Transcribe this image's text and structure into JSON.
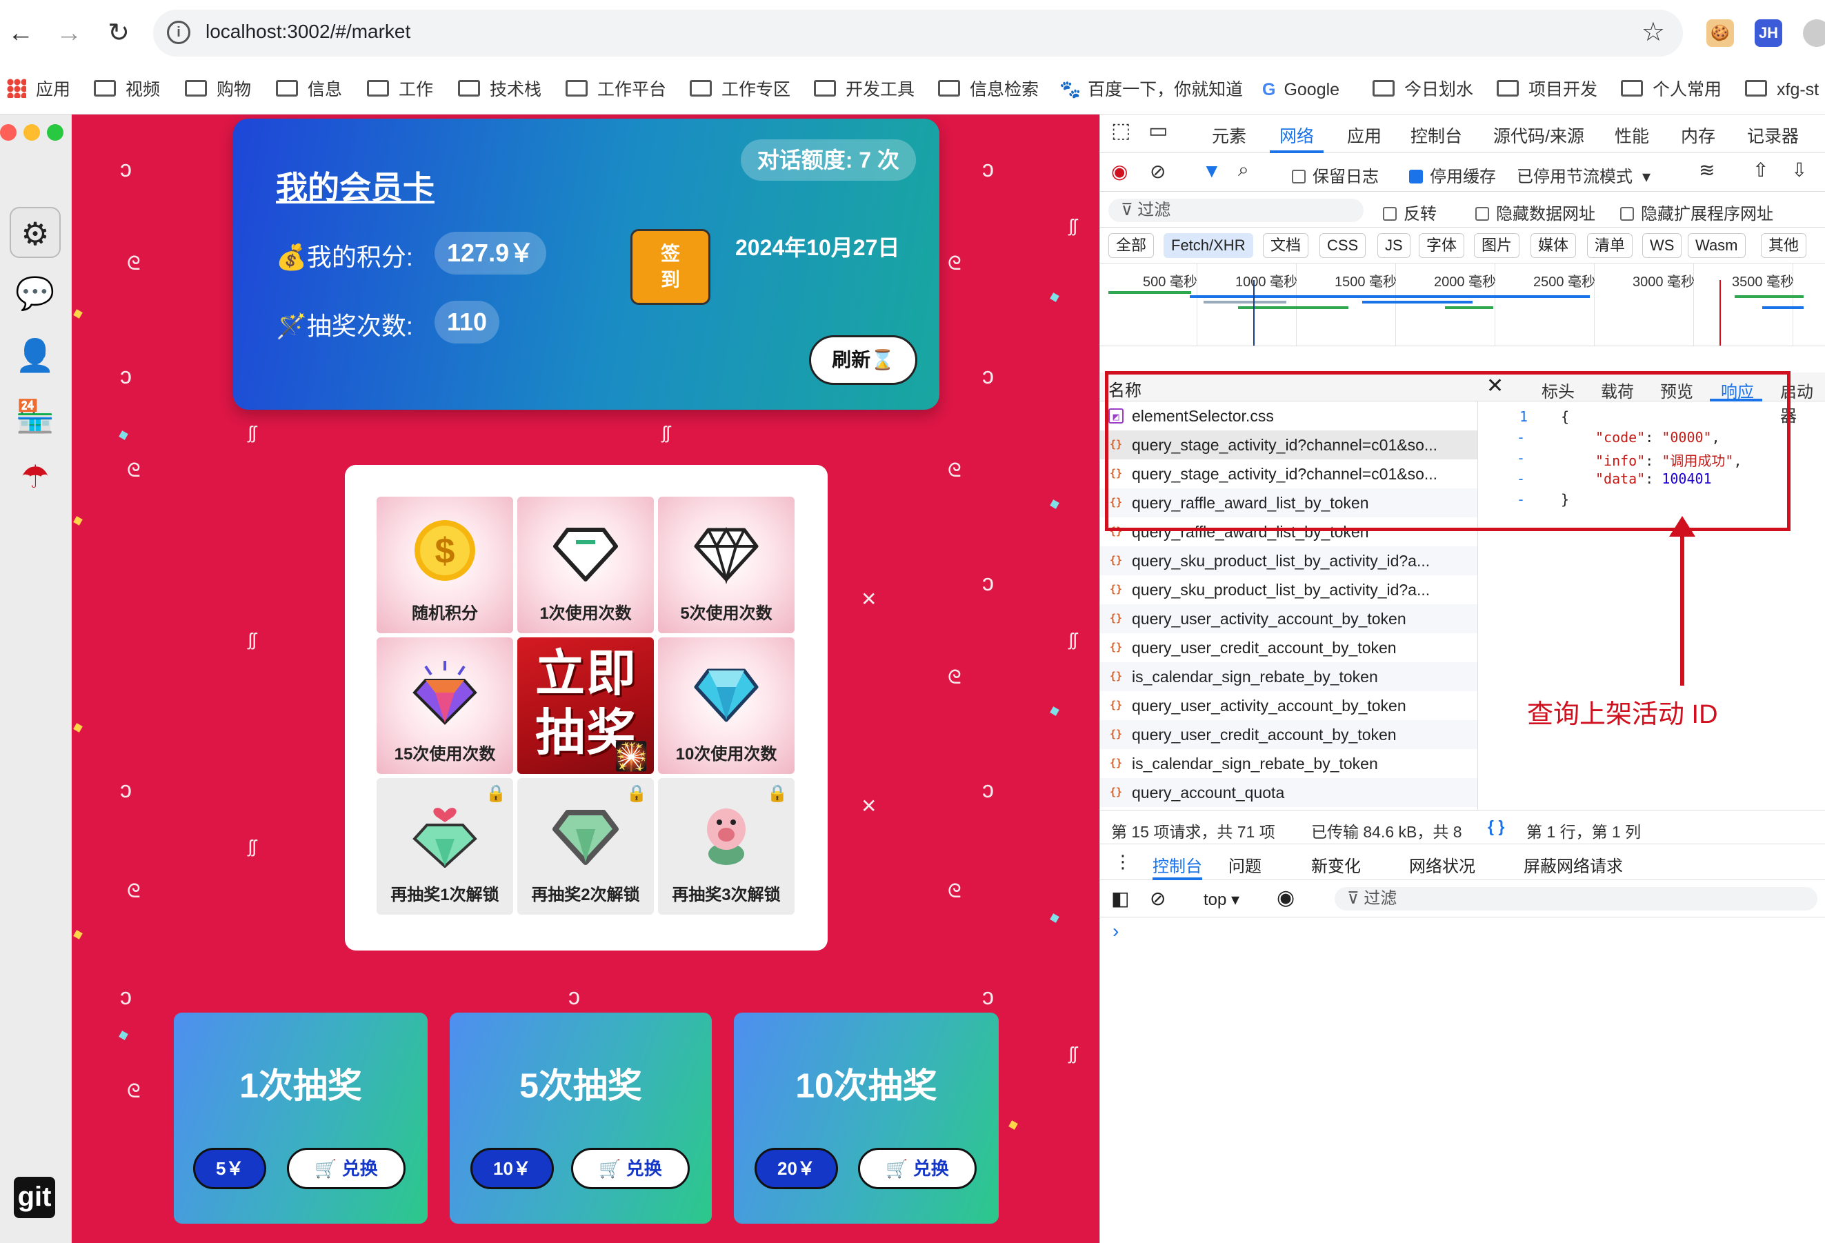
{
  "browser": {
    "url": "localhost:3002/#/market",
    "bookmarks": [
      "应用",
      "视频",
      "购物",
      "信息",
      "工作",
      "技术栈",
      "工作平台",
      "工作专区",
      "开发工具",
      "信息检索",
      "百度一下，你就知道",
      "Google",
      "今日划水",
      "项目开发",
      "个人常用",
      "xfg-st"
    ],
    "ext_badge": "JH"
  },
  "card": {
    "title": "我的会员卡",
    "quota": "对话额度: 7 次",
    "points_label": "💰我的积分:",
    "points_value": "127.9￥",
    "draws_label": "🪄抽奖次数:",
    "draws_value": "110",
    "sign_button": "签到",
    "sign_line1": "签",
    "sign_line2": "到",
    "date": "2024年10月27日",
    "refresh_button": "刷新⌛"
  },
  "lottery": {
    "cells": [
      {
        "label": "随机积分",
        "icon": "coin-icon",
        "locked": false
      },
      {
        "label": "1次使用次数",
        "icon": "diamond-outline-icon",
        "locked": false
      },
      {
        "label": "5次使用次数",
        "icon": "diamond-icon",
        "locked": false
      },
      {
        "label": "15次使用次数",
        "icon": "sparkle-diamond-icon",
        "locked": false
      },
      {
        "label": "10次使用次数",
        "icon": "blue-diamond-icon",
        "locked": false
      },
      {
        "label": "再抽奖1次解锁",
        "icon": "heart-diamond-icon",
        "locked": true
      },
      {
        "label": "再抽奖2次解锁",
        "icon": "grey-diamond-icon",
        "locked": true
      },
      {
        "label": "再抽奖3次解锁",
        "icon": "pig-icon",
        "locked": true
      }
    ],
    "center_text": "立即抽奖",
    "center_line1": "立即",
    "center_line2": "抽奖"
  },
  "draw_options": [
    {
      "title": "1次抽奖",
      "price": "5￥",
      "exchange": "兑换"
    },
    {
      "title": "5次抽奖",
      "price": "10￥",
      "exchange": "兑换"
    },
    {
      "title": "10次抽奖",
      "price": "20￥",
      "exchange": "兑换"
    }
  ],
  "devtools": {
    "tabs": [
      "元素",
      "网络",
      "应用",
      "控制台",
      "源代码/来源",
      "性能",
      "内存",
      "记录器"
    ],
    "active_tab": "网络",
    "toolbar": {
      "preserve_log": "保留日志",
      "disable_cache": "停用缓存",
      "throttle": "已停用节流模式"
    },
    "filter": {
      "placeholder": "过滤",
      "invert": "反转",
      "hide_data_urls": "隐藏数据网址",
      "hide_ext_urls": "隐藏扩展程序网址"
    },
    "types": [
      "全部",
      "Fetch/XHR",
      "文档",
      "CSS",
      "JS",
      "字体",
      "图片",
      "媒体",
      "清单",
      "WS",
      "Wasm",
      "其他"
    ],
    "active_type": "Fetch/XHR",
    "timeline_labels": [
      "500 毫秒",
      "1000 毫秒",
      "1500 毫秒",
      "2000 毫秒",
      "2500 毫秒",
      "3000 毫秒",
      "3500 毫秒"
    ],
    "name_header": "名称",
    "detail_tabs": [
      "标头",
      "载荷",
      "预览",
      "响应",
      "启动器"
    ],
    "active_detail_tab": "响应",
    "requests": [
      "elementSelector.css",
      "query_stage_activity_id?channel=c01&so...",
      "query_stage_activity_id?channel=c01&so...",
      "query_raffle_award_list_by_token",
      "query_raffle_award_list_by_token",
      "query_sku_product_list_by_activity_id?a...",
      "query_sku_product_list_by_activity_id?a...",
      "query_user_activity_account_by_token",
      "query_user_credit_account_by_token",
      "is_calendar_sign_rebate_by_token",
      "query_user_activity_account_by_token",
      "query_user_credit_account_by_token",
      "is_calendar_sign_rebate_by_token",
      "query_account_quota"
    ],
    "response": {
      "line_number": "1",
      "open": "{",
      "code_key": "\"code\"",
      "code_val": "\"0000\"",
      "info_key": "\"info\"",
      "info_val": "\"调用成功\"",
      "data_key": "\"data\"",
      "data_val": "100401",
      "close": "}"
    },
    "status": {
      "count": "第 15 项请求，共 71 项",
      "transferred": "已传输 84.6 kB，共 8",
      "cursor": "第 1 行，第 1 列",
      "format": "{ }"
    },
    "drawer_tabs": [
      "控制台",
      "问题",
      "新变化",
      "网络状况",
      "屏蔽网络请求"
    ],
    "console": {
      "context": "top ▾",
      "filter": "过滤",
      "prompt": "›"
    }
  },
  "annotation": "查询上架活动 ID",
  "left_dock": {
    "git_label": "git"
  }
}
